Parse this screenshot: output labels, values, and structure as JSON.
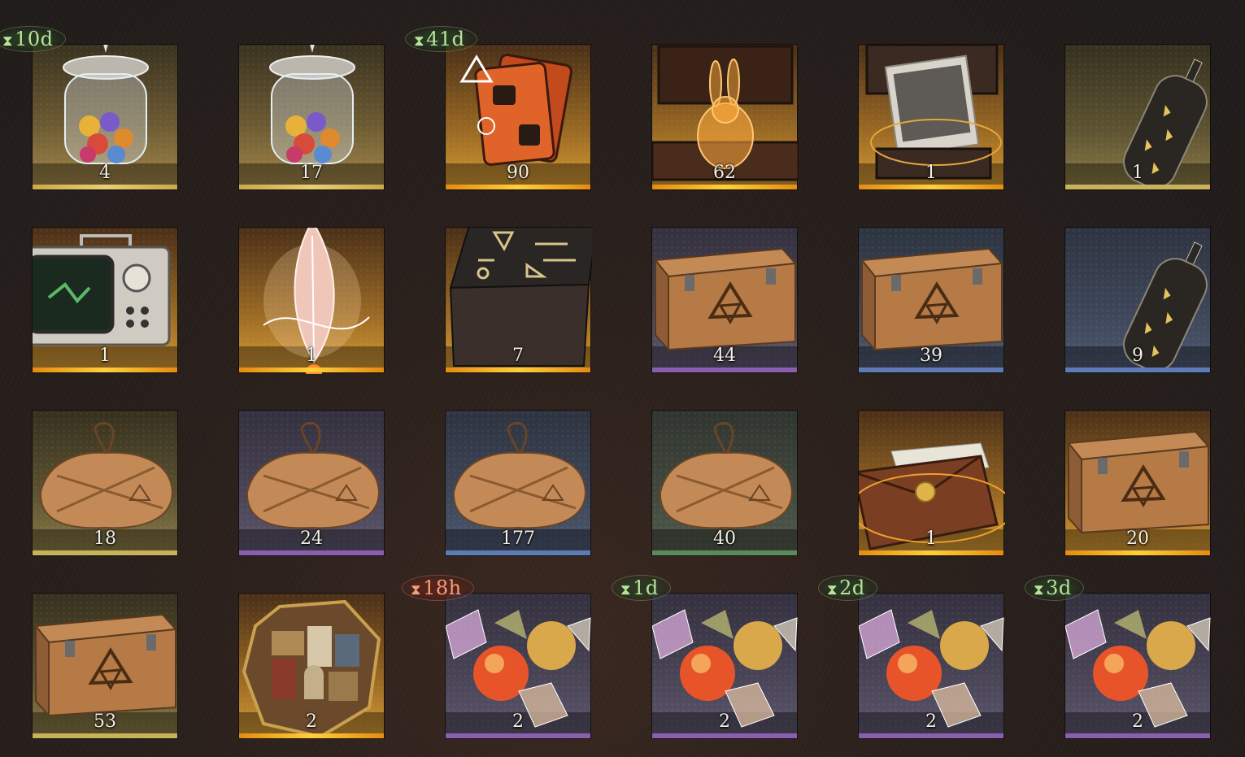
{
  "inventory": {
    "items": [
      {
        "name": "marble-jar",
        "count": "4",
        "timer": "10d",
        "timer_color": "green"
      },
      {
        "name": "marble-jar",
        "count": "17"
      },
      {
        "name": "orange-card-pack",
        "count": "90",
        "timer": "41d",
        "timer_color": "green"
      },
      {
        "name": "glowing-rabbit-chest",
        "count": "62"
      },
      {
        "name": "photo-chest",
        "count": "1"
      },
      {
        "name": "message-bottle",
        "count": "1"
      },
      {
        "name": "retro-tv",
        "count": "1"
      },
      {
        "name": "glowing-feather",
        "count": "1"
      },
      {
        "name": "rune-cube",
        "count": "7"
      },
      {
        "name": "wooden-crate",
        "count": "44"
      },
      {
        "name": "wooden-crate",
        "count": "39"
      },
      {
        "name": "message-bottle",
        "count": "9"
      },
      {
        "name": "paper-parcel",
        "count": "18"
      },
      {
        "name": "paper-parcel",
        "count": "24"
      },
      {
        "name": "paper-parcel",
        "count": "177"
      },
      {
        "name": "paper-parcel",
        "count": "40"
      },
      {
        "name": "sealed-envelope",
        "count": "1"
      },
      {
        "name": "wooden-crate",
        "count": "20"
      },
      {
        "name": "wooden-crate",
        "count": "53"
      },
      {
        "name": "wooden-puzzle",
        "count": "2"
      },
      {
        "name": "candy",
        "count": "2",
        "timer": "18h",
        "timer_color": "red"
      },
      {
        "name": "candy",
        "count": "2",
        "timer": "1d",
        "timer_color": "green"
      },
      {
        "name": "candy",
        "count": "2",
        "timer": "2d",
        "timer_color": "green"
      },
      {
        "name": "candy",
        "count": "2",
        "timer": "3d",
        "timer_color": "green"
      }
    ]
  }
}
